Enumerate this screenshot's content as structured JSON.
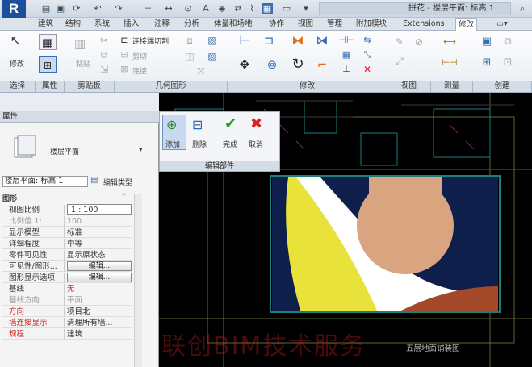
{
  "app": {
    "logo": "R",
    "title": "拼花 - 楼层平面: 标高 1"
  },
  "tabs": [
    "建筑",
    "结构",
    "系统",
    "插入",
    "注释",
    "分析",
    "体量和场地",
    "协作",
    "视图",
    "管理",
    "附加模块",
    "Extensions",
    "修改"
  ],
  "active_tab": "修改",
  "ribbon": {
    "groups": [
      "选择",
      "属性",
      "剪贴板",
      "几何图形",
      "修改",
      "视图",
      "测量",
      "创建"
    ],
    "modify_label": "修改",
    "paste_label": "粘贴",
    "geom_items": [
      "连接端切割",
      "剪切",
      "连接"
    ]
  },
  "properties": {
    "title": "属性",
    "type_name": "楼层平面",
    "view_selector": "楼层平面: 标高 1",
    "edit_type": "编辑类型",
    "section": "图形",
    "rows": [
      {
        "key": "视图比例",
        "value": "1 : 100"
      },
      {
        "key": "比例值 1:",
        "value": "100"
      },
      {
        "key": "显示模型",
        "value": "标准"
      },
      {
        "key": "详细程度",
        "value": "中等"
      },
      {
        "key": "零件可见性",
        "value": "显示原状态"
      },
      {
        "key": "可见性/图形...",
        "value": "编辑..."
      },
      {
        "key": "图形显示选项",
        "value": "编辑..."
      },
      {
        "key": "基线",
        "value": "无"
      },
      {
        "key": "基线方向",
        "value": "平面"
      },
      {
        "key": "方向",
        "value": "项目北"
      },
      {
        "key": "墙连接显示",
        "value": "清理所有墙..."
      },
      {
        "key": "规程",
        "value": "建筑"
      }
    ]
  },
  "edit_parts": {
    "buttons": [
      "添加",
      "删除",
      "完成",
      "取消"
    ],
    "group": "编辑部件"
  },
  "canvas": {
    "caption": "五层地面铺装图"
  },
  "watermark": "联创BIM技术服务",
  "colors": {
    "dark_blue": "#0d1f4a",
    "tan": "#d9a580",
    "yellow": "#e8e23a",
    "brown": "#a44a2a"
  }
}
